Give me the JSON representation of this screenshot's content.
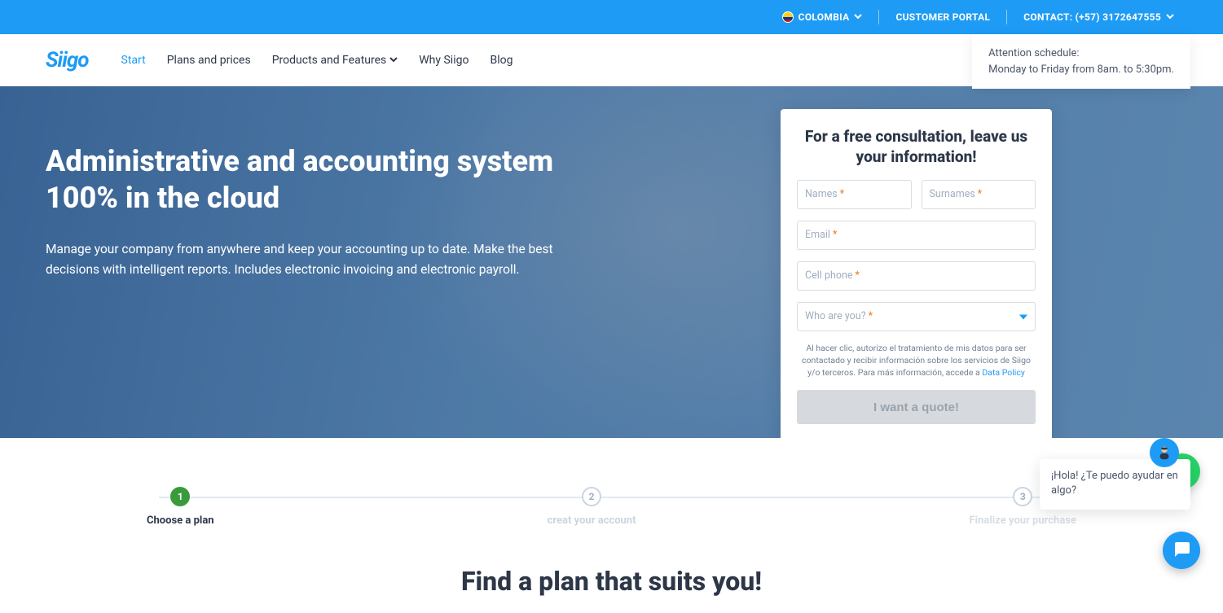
{
  "topbar": {
    "country": "COLOMBIA",
    "portal": "CUSTOMER PORTAL",
    "contact": "CONTACT: (+57) 3172647555"
  },
  "schedule": {
    "line1": "Attention schedule:",
    "line2": "Monday to Friday from 8am. to 5:30pm."
  },
  "nav": {
    "logo": "Siigo",
    "items": [
      "Start",
      "Plans and prices",
      "Products and Features",
      "Why Siigo",
      "Blog"
    ]
  },
  "hero": {
    "title": "Administrative and accounting system 100% in the cloud",
    "subtitle": "Manage your company from anywhere and keep your accounting up to date. Make the best decisions with intelligent reports. Includes electronic invoicing and electronic payroll."
  },
  "form": {
    "heading": "For a free consultation, leave us your information!",
    "names": "Names",
    "surnames": "Surnames",
    "email": "Email",
    "cellphone": "Cell phone",
    "who": "Who are you?",
    "legal_prefix": "Al hacer clic, autorizo el tratamiento de mis datos para ser contactado y recibir información sobre los servicios de Siigo y/o terceros. Para más información, accede a ",
    "legal_link": "Data Policy",
    "submit": "I want a quote!"
  },
  "steps": {
    "s1": {
      "num": "1",
      "label": "Choose a plan"
    },
    "s2": {
      "num": "2",
      "label": "creat your account"
    },
    "s3": {
      "num": "3",
      "label": "Finalize your purchase"
    }
  },
  "plans": {
    "heading": "Find a plan that suits you!"
  },
  "chat": {
    "text": "¡Hola! ¿Te puedo ayudar en algo?"
  }
}
